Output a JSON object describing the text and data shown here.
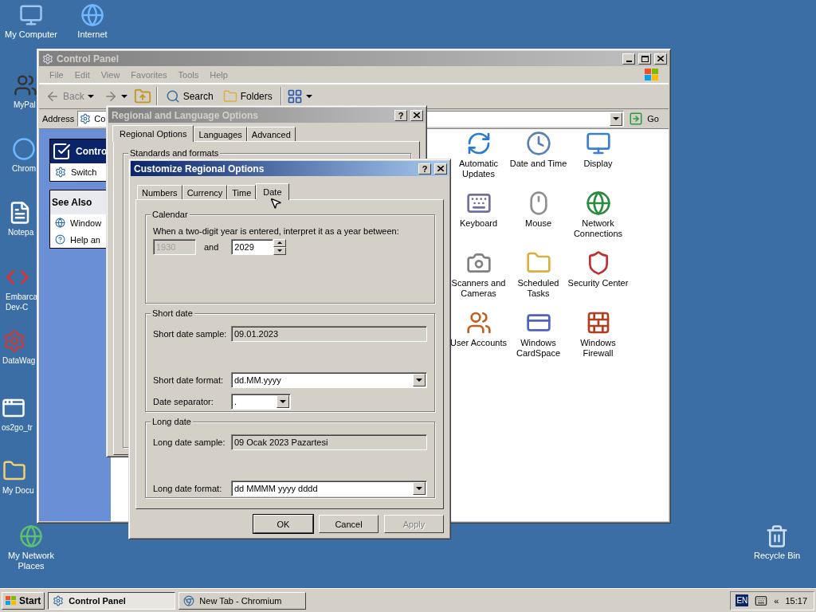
{
  "desktop_icons": [
    {
      "label": "My Computer"
    },
    {
      "label": "Internet"
    },
    {
      "label": "MyPal"
    },
    {
      "label": "Chrom"
    },
    {
      "label": "Notepa"
    },
    {
      "label": "Embarca Dev-C"
    },
    {
      "label": "DataWag"
    },
    {
      "label": "os2go_tr"
    },
    {
      "label": "My Docu"
    },
    {
      "label": "My Network Places"
    },
    {
      "label": "Recycle Bin"
    }
  ],
  "control_panel": {
    "title": "Control Panel",
    "active": false,
    "menu": [
      "File",
      "Edit",
      "View",
      "Favorites",
      "Tools",
      "Help"
    ],
    "toolbar": {
      "back": "Back",
      "search": "Search",
      "folders": "Folders"
    },
    "address": {
      "label": "Address",
      "value": "Co",
      "go": "Go"
    },
    "task_panel": {
      "title": "Contro",
      "item": "Switch"
    },
    "see_also": {
      "title": "See Also",
      "items": [
        "Window",
        "Help an"
      ]
    },
    "items": [
      {
        "label": "Automatic Updates"
      },
      {
        "label": "Date and Time"
      },
      {
        "label": "Display"
      },
      {
        "label": "Keyboard"
      },
      {
        "label": "Mouse"
      },
      {
        "label": "Network Connections"
      },
      {
        "label": "Scanners and Cameras"
      },
      {
        "label": "Scheduled Tasks"
      },
      {
        "label": "Security Center"
      },
      {
        "label": "User Accounts"
      },
      {
        "label": "Windows CardSpace"
      },
      {
        "label": "Windows Firewall"
      }
    ]
  },
  "regional_dialog": {
    "title": "Regional and Language Options",
    "active": false,
    "help_button": "?",
    "tabs": [
      {
        "label": "Regional Options",
        "selected": true
      },
      {
        "label": "Languages",
        "selected": false
      },
      {
        "label": "Advanced",
        "selected": false
      }
    ],
    "group": "Standards and formats"
  },
  "customize_dialog": {
    "title": "Customize Regional Options",
    "active": true,
    "help_button": "?",
    "tabs": [
      {
        "label": "Numbers",
        "selected": false
      },
      {
        "label": "Currency",
        "selected": false
      },
      {
        "label": "Time",
        "selected": false
      },
      {
        "label": "Date",
        "selected": true
      }
    ],
    "calendar": {
      "title": "Calendar",
      "text": "When a two-digit year is entered, interpret it as a year between:",
      "from": {
        "value": "1930",
        "disabled": true
      },
      "and": "and",
      "to": {
        "value": "2029",
        "disabled": false
      }
    },
    "short_date": {
      "title": "Short date",
      "sample_label": "Short date sample:",
      "sample": "09.01.2023",
      "format_label": "Short date format:",
      "format": "dd.MM.yyyy",
      "separator_label": "Date separator:",
      "separator": "."
    },
    "long_date": {
      "title": "Long date",
      "sample_label": "Long date sample:",
      "sample": "09 Ocak 2023 Pazartesi",
      "format_label": "Long date format:",
      "format": "dd MMMM yyyy dddd"
    },
    "buttons": [
      {
        "label": "OK",
        "disabled": false
      },
      {
        "label": "Cancel",
        "disabled": false
      },
      {
        "label": "Apply",
        "disabled": true
      }
    ]
  },
  "taskbar": {
    "start": "Start",
    "tasks": [
      {
        "label": "Control Panel",
        "selected": true
      },
      {
        "label": "New Tab - Chromium",
        "selected": false
      }
    ],
    "language": "EN",
    "expand": "«",
    "clock": "15:17"
  }
}
